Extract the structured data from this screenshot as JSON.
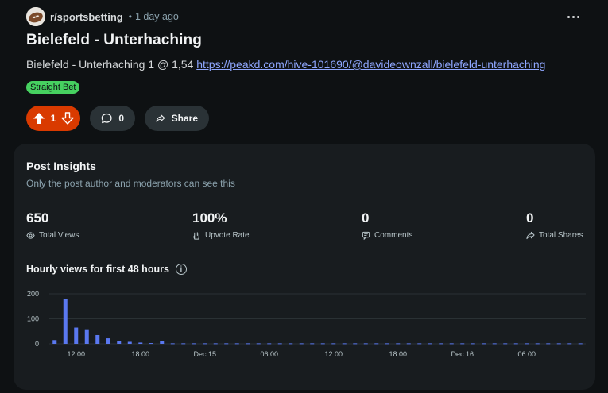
{
  "post": {
    "subreddit": "r/sportsbetting",
    "time_ago": "1 day ago",
    "separator": "•",
    "title": "Bielefeld - Unterhaching",
    "body_text": "Bielefeld - Unterhaching 1 @ 1,54 ",
    "body_link": "https://peakd.com/hive-101690/@davideownzall/bielefeld-unterhaching",
    "flair": "Straight Bet",
    "flair_color": "#46d160"
  },
  "actions": {
    "vote_count": "1",
    "vote_color": "#d93a00",
    "comment_count": "0",
    "share_label": "Share"
  },
  "insights": {
    "title": "Post Insights",
    "subtitle": "Only the post author and moderators can see this",
    "stats": [
      {
        "value": "650",
        "label": "Total Views",
        "icon": "eye-icon"
      },
      {
        "value": "100%",
        "label": "Upvote Rate",
        "icon": "hand-icon"
      },
      {
        "value": "0",
        "label": "Comments",
        "icon": "comment-icon"
      },
      {
        "value": "0",
        "label": "Total Shares",
        "icon": "share-icon"
      }
    ],
    "chart_title": "Hourly views for first 48 hours"
  },
  "chart_data": {
    "type": "bar",
    "color": "#5a78f0",
    "ylim": [
      0,
      200
    ],
    "yticks": [
      "200",
      "100",
      "0"
    ],
    "xticks": [
      "12:00",
      "18:00",
      "Dec 15",
      "06:00",
      "12:00",
      "18:00",
      "Dec 16",
      "06:00"
    ],
    "values": [
      15,
      180,
      65,
      55,
      35,
      22,
      12,
      8,
      5,
      3,
      10,
      2,
      2,
      2,
      2,
      2,
      2,
      2,
      2,
      2,
      2,
      2,
      2,
      2,
      2,
      2,
      2,
      2,
      2,
      2,
      2,
      2,
      2,
      2,
      2,
      2,
      2,
      2,
      2,
      2,
      2,
      2,
      2,
      2,
      2,
      2,
      2,
      2,
      2,
      2
    ]
  }
}
